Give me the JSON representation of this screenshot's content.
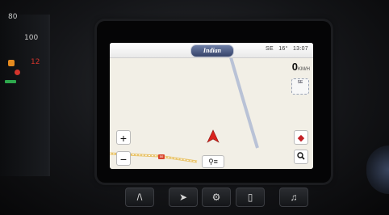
{
  "cluster": {
    "gauge_top": "80",
    "gauge_mid": "100",
    "gauge_low": "12"
  },
  "screen": {
    "brand_logo": "Indian",
    "status": {
      "heading": "SE",
      "temperature": "16°",
      "clock": "13:07"
    },
    "speed": {
      "value": "0",
      "unit": "KM/H"
    },
    "compass": {
      "label": "SE",
      "icon": "compass-icon"
    },
    "controls": {
      "zoom_in": "+",
      "zoom_out": "−",
      "poi_icon": "poi-icon",
      "search_icon": "search-icon",
      "menu_icon": "menu-icon"
    },
    "road_badge": "50",
    "colors": {
      "map_bg": "#f2efe6",
      "position_arrow": "#d9231d",
      "road_major": "#e9c46a",
      "road_minor": "#b9c2d6"
    }
  },
  "hardware_buttons": [
    {
      "icon": "road-icon"
    },
    {
      "icon": "navigate-arrow-icon"
    },
    {
      "icon": "settings-gear-icon"
    },
    {
      "icon": "phone-icon"
    },
    {
      "icon": "music-note-icon"
    }
  ]
}
